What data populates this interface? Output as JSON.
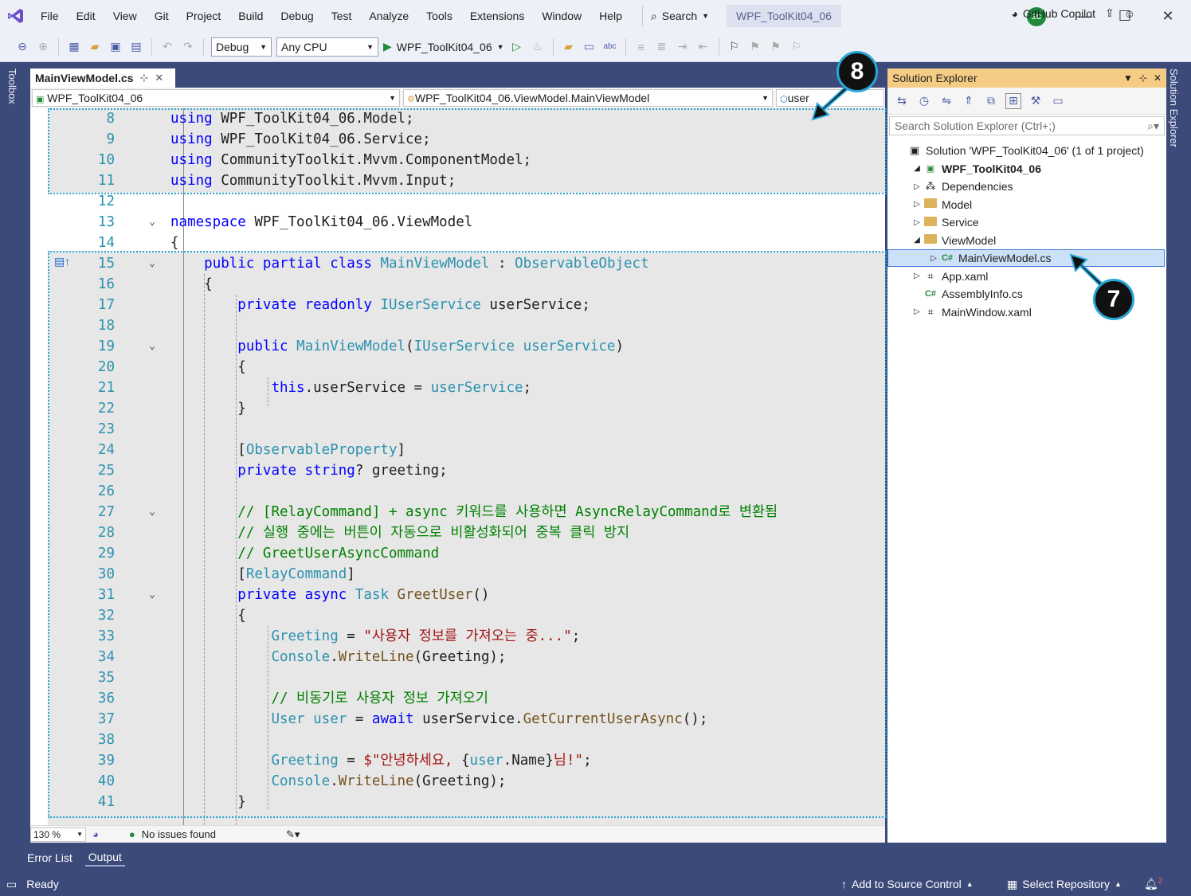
{
  "menu": {
    "items": [
      "File",
      "Edit",
      "View",
      "Git",
      "Project",
      "Build",
      "Debug",
      "Test",
      "Analyze",
      "Tools",
      "Extensions",
      "Window",
      "Help"
    ],
    "search_label": "Search",
    "solution_title": "WPF_ToolKit04_06",
    "avatar_initials": "SC"
  },
  "toolbar": {
    "config": "Debug",
    "platform": "Any CPU",
    "run_target": "WPF_ToolKit04_06",
    "copilot_label": "GitHub Copilot"
  },
  "toolbox": {
    "label": "Toolbox"
  },
  "editor": {
    "tab_label": "MainViewModel.cs",
    "nav_project": "WPF_ToolKit04_06",
    "nav_class": "WPF_ToolKit04_06.ViewModel.MainViewModel",
    "nav_member": "user",
    "zoom": "130 %",
    "issues": "No issues found"
  },
  "code_lines": [
    {
      "n": "8",
      "html": "<span class='kw'>using</span> WPF_ToolKit04_06.Model;"
    },
    {
      "n": "9",
      "html": "<span class='kw'>using</span> WPF_ToolKit04_06.Service;"
    },
    {
      "n": "10",
      "html": "<span class='kw'>using</span> CommunityToolkit.Mvvm.ComponentModel;"
    },
    {
      "n": "11",
      "html": "<span class='kw'>using</span> CommunityToolkit.Mvvm.Input;"
    },
    {
      "n": "12",
      "html": ""
    },
    {
      "n": "13",
      "html": "<span class='kw'>namespace</span> WPF_ToolKit04_06.ViewModel"
    },
    {
      "n": "14",
      "html": "{"
    },
    {
      "n": "15",
      "html": "    <span class='kw'>public</span> <span class='kw'>partial</span> <span class='kw'>class</span> <span class='ty'>MainViewModel</span> : <span class='ty'>ObservableObject</span>"
    },
    {
      "n": "16",
      "html": "    {"
    },
    {
      "n": "17",
      "html": "        <span class='kw'>private</span> <span class='kw'>readonly</span> <span class='ty'>IUserService</span> userService;"
    },
    {
      "n": "18",
      "html": ""
    },
    {
      "n": "19",
      "html": "        <span class='kw'>public</span> <span class='ty'>MainViewModel</span>(<span class='ty'>IUserService</span> <span class='ty'>userService</span>)"
    },
    {
      "n": "20",
      "html": "        {"
    },
    {
      "n": "21",
      "html": "            <span class='kw'>this</span>.userService = <span class='ty'>userService</span>;"
    },
    {
      "n": "22",
      "html": "        }"
    },
    {
      "n": "23",
      "html": ""
    },
    {
      "n": "24",
      "html": "        [<span class='ty'>ObservableProperty</span>]"
    },
    {
      "n": "25",
      "html": "        <span class='kw'>private</span> <span class='kw'>string</span>? greeting;"
    },
    {
      "n": "26",
      "html": ""
    },
    {
      "n": "27",
      "html": "        <span class='cm'>// [RelayCommand] + async 키워드를 사용하면 AsyncRelayCommand로 변환됨</span>"
    },
    {
      "n": "28",
      "html": "        <span class='cm'>// 실행 중에는 버튼이 자동으로 비활성화되어 중복 클릭 방지</span>"
    },
    {
      "n": "29",
      "html": "        <span class='cm'>// GreetUserAsyncCommand</span>"
    },
    {
      "n": "30",
      "html": "        [<span class='ty'>RelayCommand</span>]"
    },
    {
      "n": "31",
      "html": "        <span class='kw'>private</span> <span class='kw'>async</span> <span class='ty'>Task</span> <span class='mt'>GreetUser</span>()"
    },
    {
      "n": "32",
      "html": "        {"
    },
    {
      "n": "33",
      "html": "            <span class='ty'>Greeting</span> = <span class='st'>\"사용자 정보를 가져오는 중...\"</span>;"
    },
    {
      "n": "34",
      "html": "            <span class='ty'>Console</span>.<span class='mt'>WriteLine</span>(Greeting);"
    },
    {
      "n": "35",
      "html": ""
    },
    {
      "n": "36",
      "html": "            <span class='cm'>// 비동기로 사용자 정보 가져오기</span>"
    },
    {
      "n": "37",
      "html": "            <span class='ty'>User</span> <span class='ty'>user</span> = <span class='kw'>await</span> userService.<span class='mt'>GetCurrentUserAsync</span>();"
    },
    {
      "n": "38",
      "html": ""
    },
    {
      "n": "39",
      "html": "            <span class='ty'>Greeting</span> = <span class='st'>$\"안녕하세요, </span>{<span class='ty'>user</span>.Name}<span class='st'>님!\"</span>;"
    },
    {
      "n": "40",
      "html": "            <span class='ty'>Console</span>.<span class='mt'>WriteLine</span>(Greeting);"
    },
    {
      "n": "41",
      "html": "        }"
    }
  ],
  "solution_explorer": {
    "title": "Solution Explorer",
    "search_placeholder": "Search Solution Explorer (Ctrl+;)",
    "side_label": "Solution Explorer",
    "items": [
      {
        "label": "Solution 'WPF_ToolKit04_06' (1 of 1 project)",
        "icon": "solution-icon",
        "expander": ""
      },
      {
        "label": "WPF_ToolKit04_06",
        "icon": "csproj-icon",
        "expander": "◢"
      },
      {
        "label": "Dependencies",
        "icon": "dependencies-icon",
        "expander": "▷"
      },
      {
        "label": "Model",
        "icon": "folder-icon",
        "expander": "▷"
      },
      {
        "label": "Service",
        "icon": "folder-icon",
        "expander": "▷"
      },
      {
        "label": "ViewModel",
        "icon": "folder-icon",
        "expander": "◢"
      },
      {
        "label": "MainViewModel.cs",
        "icon": "csharp-file-icon",
        "expander": "▷"
      },
      {
        "label": "App.xaml",
        "icon": "xaml-file-icon",
        "expander": "▷"
      },
      {
        "label": "AssemblyInfo.cs",
        "icon": "csharp-file-icon",
        "expander": ""
      },
      {
        "label": "MainWindow.xaml",
        "icon": "xaml-file-icon",
        "expander": "▷"
      }
    ]
  },
  "bottom_tabs": [
    "Error List",
    "Output"
  ],
  "statusbar": {
    "ready": "Ready",
    "source_control": "Add to Source Control",
    "repository": "Select Repository",
    "notifications": "2"
  },
  "callouts": [
    "8",
    "7"
  ]
}
